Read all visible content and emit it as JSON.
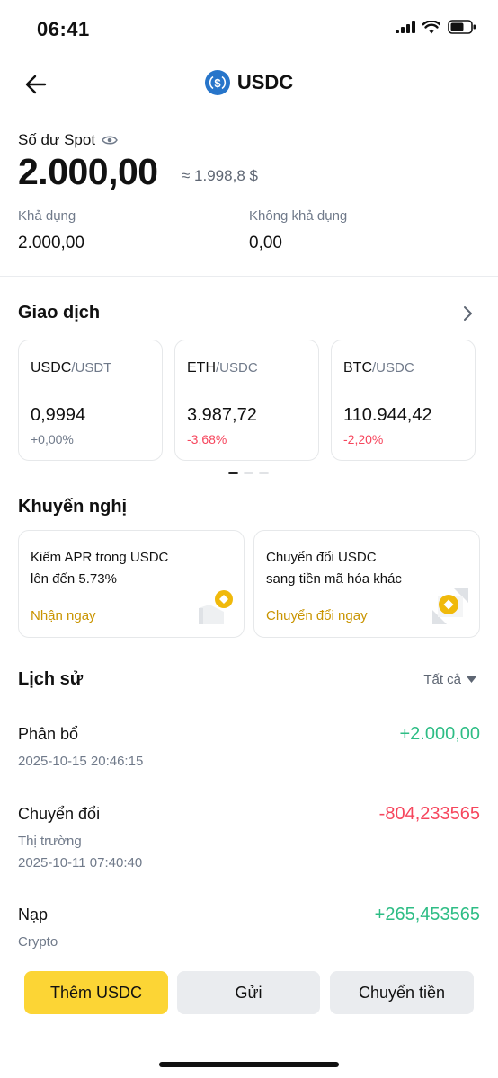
{
  "status_bar": {
    "time": "06:41"
  },
  "header": {
    "title": "USDC"
  },
  "balance": {
    "label": "Số dư Spot",
    "amount": "2.000,00",
    "approx": "≈ 1.998,8 $",
    "available_label": "Khả dụng",
    "available_value": "2.000,00",
    "unavailable_label": "Không khả dụng",
    "unavailable_value": "0,00"
  },
  "trade": {
    "title": "Giao dịch",
    "pairs": [
      {
        "base": "USDC",
        "quote": "/USDT",
        "price": "0,9994",
        "change": "+0,00%"
      },
      {
        "base": "ETH",
        "quote": "/USDC",
        "price": "3.987,72",
        "change": "-3,68%"
      },
      {
        "base": "BTC",
        "quote": "/USDC",
        "price": "110.944,42",
        "change": "-2,20%"
      }
    ]
  },
  "recommend": {
    "title": "Khuyến nghị",
    "cards": [
      {
        "text": "Kiếm APR trong USDC\nlên đến 5.73%",
        "cta": "Nhận ngay",
        "icon": "earn-coin-icon"
      },
      {
        "text": "Chuyển đổi USDC\nsang tiền mã hóa khác",
        "cta": "Chuyển đổi ngay",
        "icon": "convert-coin-icon"
      }
    ]
  },
  "history": {
    "title": "Lịch sử",
    "filter": "Tất cả",
    "items": [
      {
        "title": "Phân bổ",
        "sub1": "2025-10-15 20:46:15",
        "amount": "+2.000,00"
      },
      {
        "title": "Chuyển đổi",
        "sub1": "Thị trường",
        "sub2": "2025-10-11 07:40:40",
        "amount": "-804,233565"
      },
      {
        "title": "Nạp",
        "sub1": "Crypto",
        "amount": "+265,453565"
      }
    ]
  },
  "actions": {
    "add": "Thêm USDC",
    "send": "Gửi",
    "transfer": "Chuyển tiền"
  },
  "colors": {
    "accent": "#fcd535",
    "positive": "#2ebd85",
    "negative": "#f6465d",
    "cta_text": "#c99400",
    "usdc_blue": "#2775ca"
  }
}
